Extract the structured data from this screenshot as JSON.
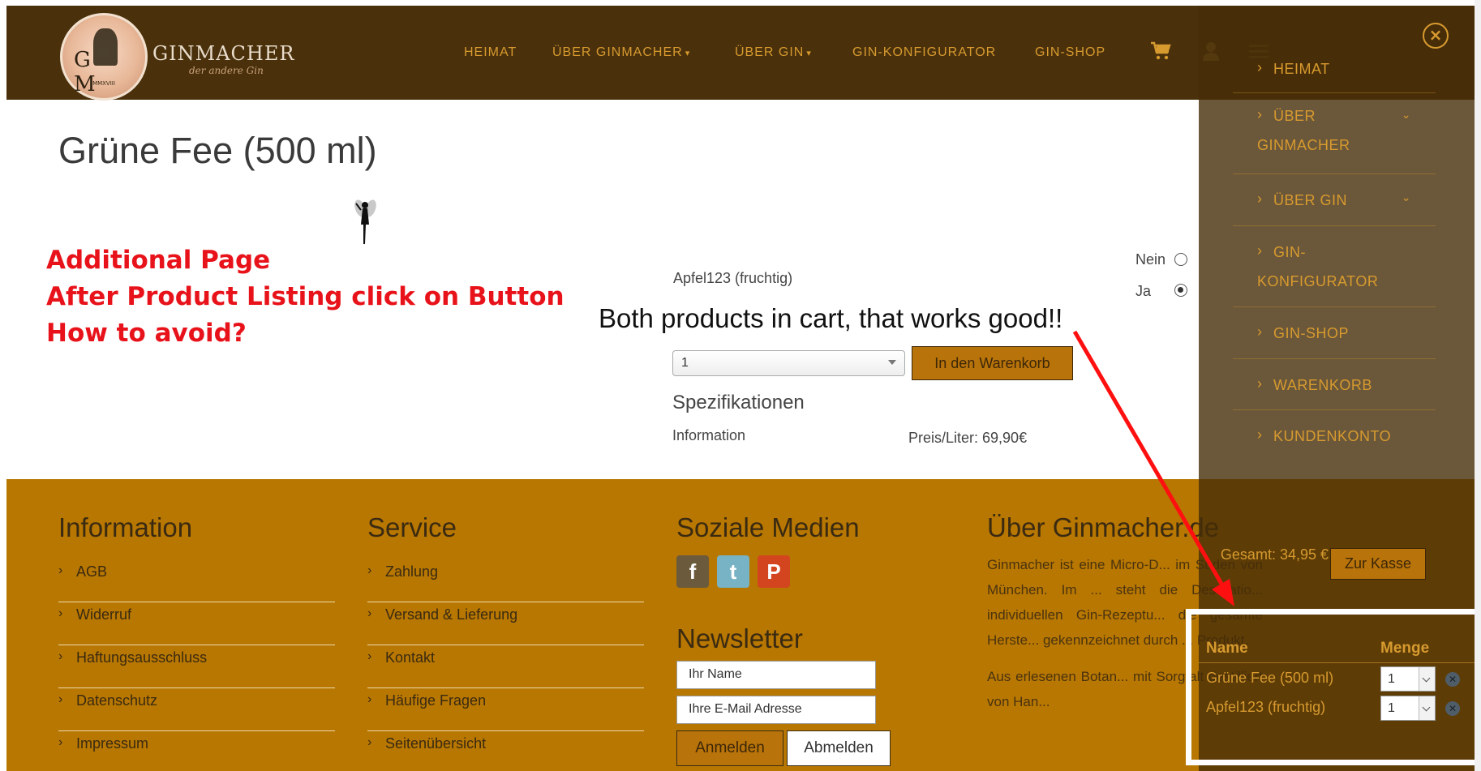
{
  "header": {
    "logo_monogram": "G M",
    "logo_year": "MMXVIII",
    "logo_name": "GINMACHER",
    "logo_tagline": "der andere Gin",
    "nav": [
      {
        "label": "HEIMAT",
        "has_dropdown": false
      },
      {
        "label": "ÜBER GINMACHER",
        "has_dropdown": true
      },
      {
        "label": "ÜBER GIN",
        "has_dropdown": true
      },
      {
        "label": "GIN-KONFIGURATOR",
        "has_dropdown": false
      },
      {
        "label": "GIN-SHOP",
        "has_dropdown": false
      }
    ],
    "icons": [
      "cart-icon",
      "user-icon",
      "menu-icon"
    ]
  },
  "product": {
    "title": "Grüne Fee (500 ml)",
    "option_label": "Apfel123 (fruchtig)",
    "radio_options": [
      {
        "label": "Nein",
        "checked": false
      },
      {
        "label": "Ja",
        "checked": true
      }
    ],
    "quantity": "1",
    "add_to_cart": "In den Warenkorb",
    "spec_title": "Spezifikationen",
    "spec_info_label": "Information",
    "spec_price": "Preis/Liter: 69,90€"
  },
  "annotation": {
    "lines": [
      "Additional Page",
      "After Product Listing click on Button",
      "How to avoid?"
    ],
    "callout": "Both products in cart, that works good!!"
  },
  "footer": {
    "information": {
      "title": "Information",
      "links": [
        "AGB",
        "Widerruf",
        "Haftungsausschluss",
        "Datenschutz",
        "Impressum"
      ]
    },
    "service": {
      "title": "Service",
      "links": [
        "Zahlung",
        "Versand & Lieferung",
        "Kontakt",
        "Häufige Fragen",
        "Seitenübersicht"
      ]
    },
    "social": {
      "title": "Soziale Medien",
      "icons": [
        {
          "name": "facebook-icon",
          "glyph": "f",
          "color": "#6b5a3c"
        },
        {
          "name": "twitter-icon",
          "glyph": "t",
          "color": "#77b3c4"
        },
        {
          "name": "pinterest-icon",
          "glyph": "P",
          "color": "#d2451e"
        }
      ]
    },
    "newsletter": {
      "title": "Newsletter",
      "name_placeholder": "Ihr Name",
      "email_placeholder": "Ihre E-Mail Adresse",
      "subscribe": "Anmelden",
      "unsubscribe": "Abmelden"
    },
    "about": {
      "title": "Über Ginmacher.de",
      "text1": "Ginmacher ist eine Micro-D... im Süden von München. Im ... steht die Destillatio... individuellen Gin-Rezeptu... die gesamte Herste... gekennzeichnet durch ... Produkt.",
      "text2": "Aus erlesenen Botan... mit Sorgfalt destilliert von Han..."
    }
  },
  "side_menu": {
    "close": "×",
    "items": [
      {
        "label": "HEIMAT",
        "has_dropdown": false
      },
      {
        "label": "ÜBER GINMACHER",
        "has_dropdown": true
      },
      {
        "label": "ÜBER GIN",
        "has_dropdown": true
      },
      {
        "label": "GIN-KONFIGURATOR",
        "has_dropdown": false
      },
      {
        "label": "GIN-SHOP",
        "has_dropdown": false
      },
      {
        "label": "WARENKORB",
        "has_dropdown": false
      },
      {
        "label": "KUNDENKONTO",
        "has_dropdown": false
      }
    ],
    "total": "Gesamt: 34,95 €",
    "checkout": "Zur Kasse",
    "cart": {
      "col_name": "Name",
      "col_qty": "Menge",
      "rows": [
        {
          "name": "Grüne Fee (500 ml)",
          "qty": "1"
        },
        {
          "name": "Apfel123 (fruchtig)",
          "qty": "1"
        }
      ]
    }
  },
  "colors": {
    "header_bg": "#4a300b",
    "accent": "#d79a2f",
    "footer_bg": "#b87700",
    "button": "#b8730a",
    "annotation": "#e8131a"
  }
}
